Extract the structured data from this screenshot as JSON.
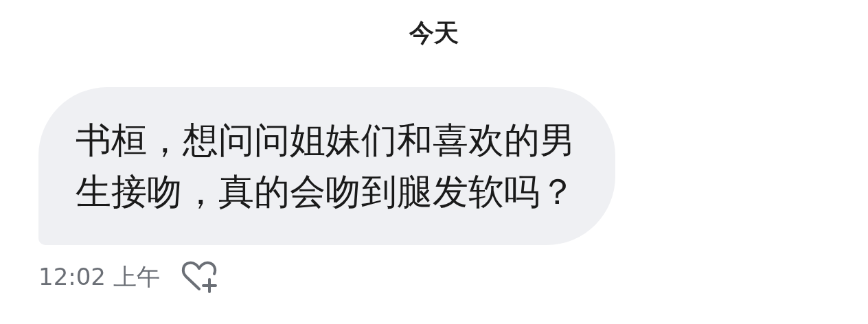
{
  "date_header": "今天",
  "message": {
    "text": "书桓，想问问姐妹们和喜欢的男生接吻，真的会吻到腿发软吗？",
    "time": "12:02 上午"
  }
}
